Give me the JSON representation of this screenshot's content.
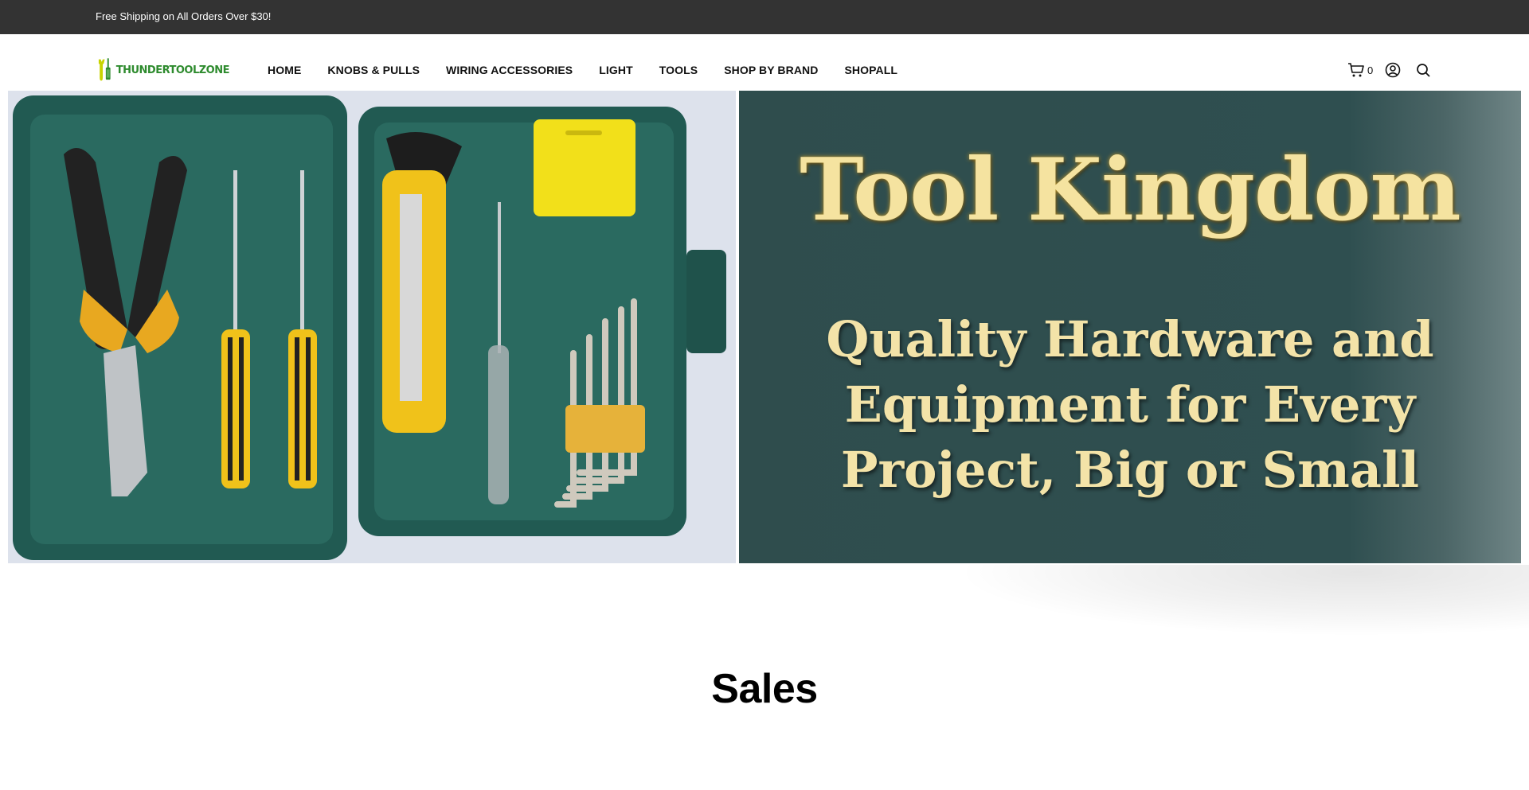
{
  "announcement": "Free Shipping on All Orders Over $30!",
  "brand": {
    "name": "THUNDERTOOLZONE",
    "primary_color": "#2e8b2e",
    "accent_color": "#c8d400"
  },
  "nav": {
    "items": [
      {
        "label": "HOME"
      },
      {
        "label": "KNOBS & PULLS"
      },
      {
        "label": "WIRING ACCESSORIES"
      },
      {
        "label": "LIGHT"
      },
      {
        "label": "TOOLS"
      },
      {
        "label": "SHOP BY BRAND"
      },
      {
        "label": "SHOPALL"
      }
    ]
  },
  "header_icons": {
    "cart_count": "0",
    "cart_icon": "cart-icon",
    "account_icon": "user-icon",
    "search_icon": "search-icon"
  },
  "hero": {
    "title": "Tool Kingdom",
    "subtitle_lines": [
      "Quality Hardware and",
      "Equipment for Every",
      "Project, Big or Small"
    ],
    "panel_color": "#2f4d4d",
    "text_color": "#f5e3a0"
  },
  "section": {
    "title": "Sales"
  }
}
